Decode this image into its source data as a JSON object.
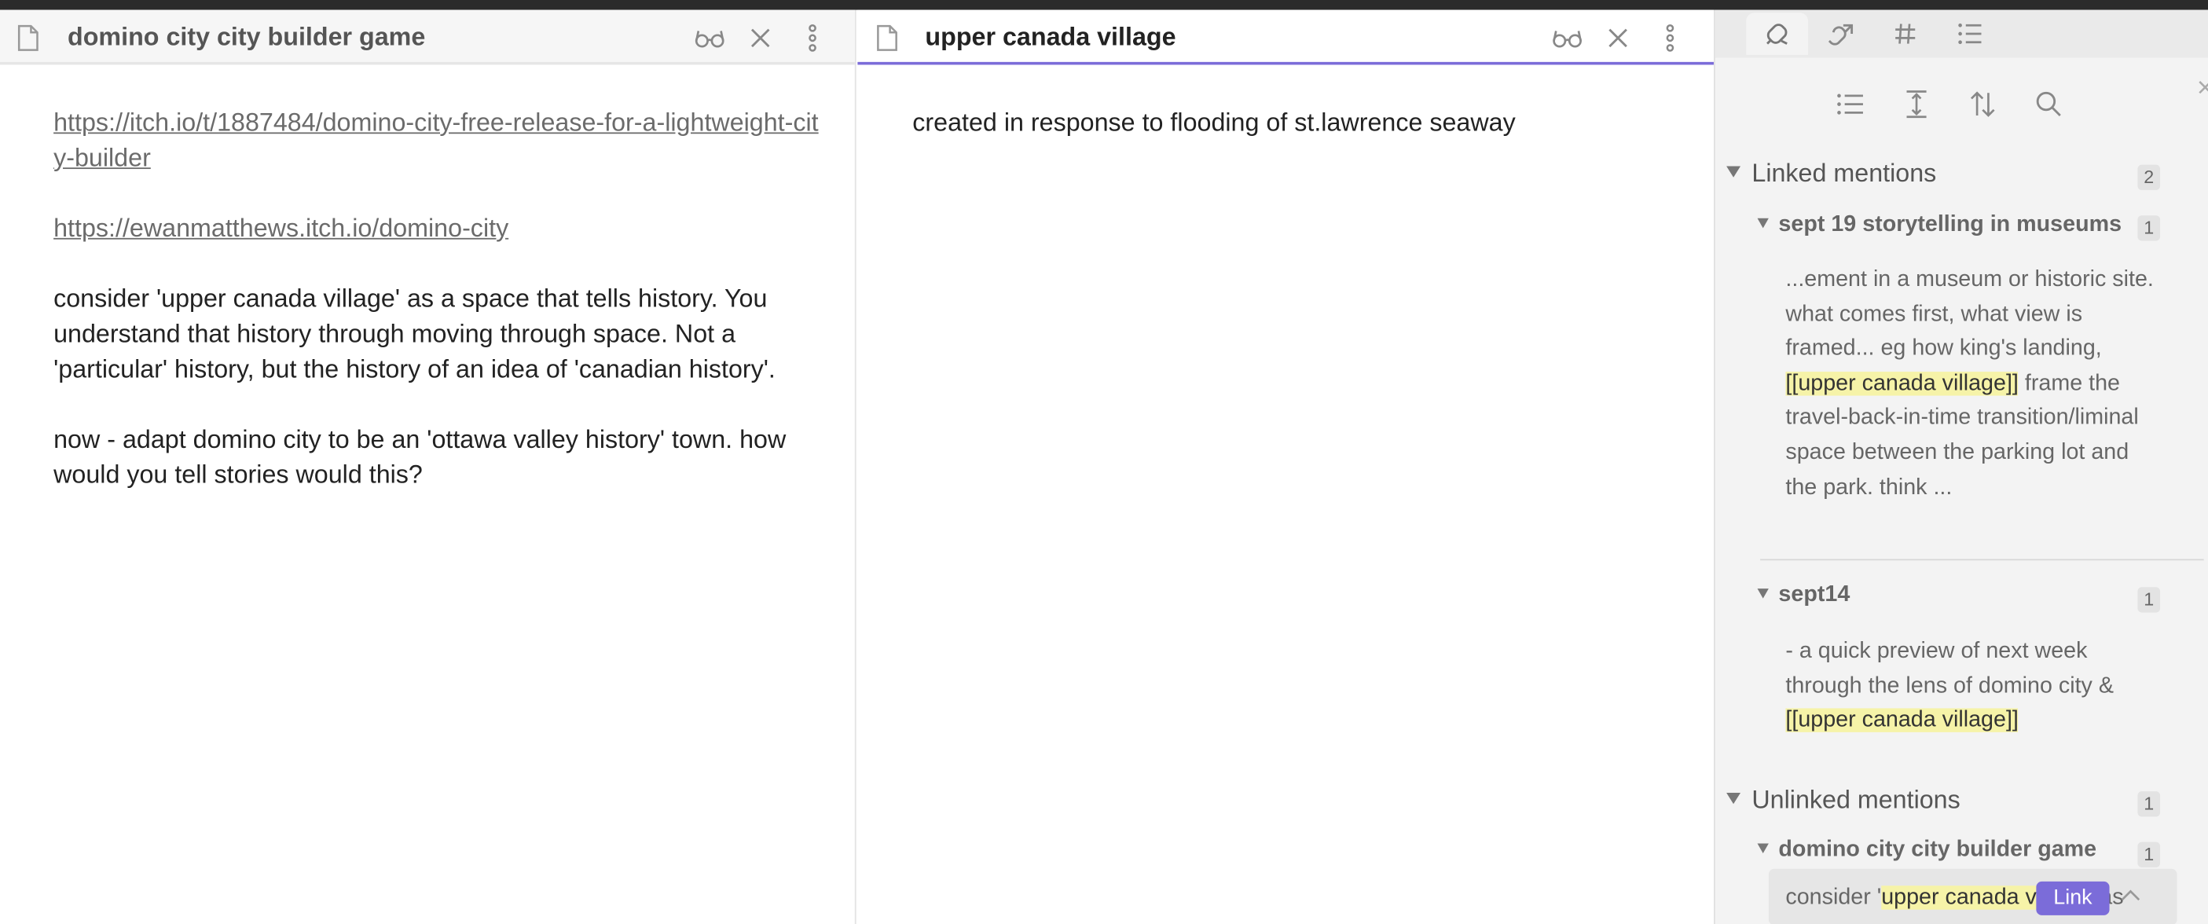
{
  "left_pane": {
    "title": "domino city city builder game",
    "link1": "https://itch.io/t/1887484/domino-city-free-release-for-a-lightweight-city-builder",
    "link2": "https://ewanmatthews.itch.io/domino-city",
    "para1": "consider 'upper canada village' as a space that tells history. You understand that history through moving through space. Not a 'particular' history, but the history of an idea of 'canadian history'.",
    "para2": "now - adapt domino city to be an 'ottawa valley history' town. how would you tell stories would this?"
  },
  "mid_pane": {
    "title": "upper canada village",
    "body": "created in response to flooding of st.lawrence seaway"
  },
  "sidebar": {
    "linked_label": "Linked mentions",
    "linked_count": "2",
    "m1": {
      "file": "sept 19 storytelling in museums",
      "count": "1",
      "pre": "...ement in a museum or historic site. what comes first, what view is framed... eg how king's landing, ",
      "hl": "[[upper canada village]]",
      "post": " frame the travel-back-in-time transition/liminal space between the parking lot and the park. think ..."
    },
    "m2": {
      "file": "sept14",
      "count": "1",
      "pre": "- a quick preview of next week through the lens of domino city & ",
      "hl": "[[upper canada village]]"
    },
    "unlinked_label": "Unlinked mentions",
    "unlinked_count": "1",
    "m3": {
      "file": "domino city city builder game",
      "count": "1",
      "pre": "consider '",
      "hl": "upper canada v",
      "post": "illage' as"
    },
    "link_button": "Link"
  }
}
